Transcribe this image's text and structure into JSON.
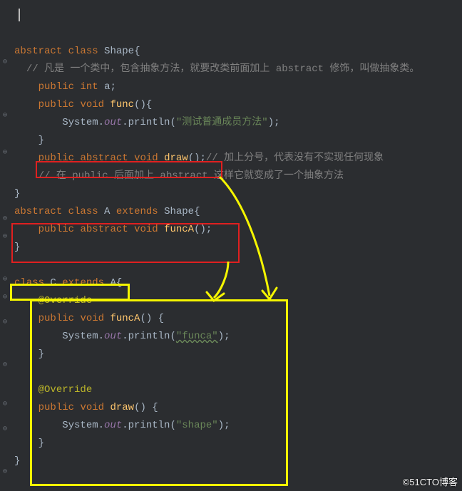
{
  "code": {
    "l1_kw1": "abstract",
    "l1_kw2": "class",
    "l1_ident": "Shape",
    "l1_brace": "{",
    "l2_comment": "// 凡是 一个类中，包含抽象方法，就要改类前面加上 abstract 修饰，叫做抽象类。",
    "l3_kw1": "public",
    "l3_kw2": "int",
    "l3_ident": "a",
    "l3_semi": ";",
    "l4_kw1": "public",
    "l4_kw2": "void",
    "l4_method": "func",
    "l4_end": "(){",
    "l5_a": "System.",
    "l5_out": "out",
    "l5_b": ".println(",
    "l5_str": "\"测试普通成员方法\"",
    "l5_c": ");",
    "l6_brace": "}",
    "l7_kw1": "public",
    "l7_kw2": "abstract",
    "l7_kw3": "void",
    "l7_method": "draw",
    "l7_end": "();",
    "l7_comment": "// 加上分号，代表没有不实现任何现象",
    "l8_comment": "// 在 public 后面加上 abstract 这样它就变成了一个抽象方法",
    "l9_brace": "}",
    "l10_kw1": "abstract",
    "l10_kw2": "class",
    "l10_a": "A",
    "l10_kw3": "extends",
    "l10_shape": "Shape",
    "l10_brace": "{",
    "l11_kw1": "public",
    "l11_kw2": "abstract",
    "l11_kw3": "void",
    "l11_method": "funcA",
    "l11_end": "();",
    "l12_brace": "}",
    "l13_kw1": "class",
    "l13_c": "C",
    "l13_kw2": "extends",
    "l13_a": "A",
    "l13_brace": "{",
    "l14_anno": "@Override",
    "l15_kw1": "public",
    "l15_kw2": "void",
    "l15_method": "funcA",
    "l15_end": "() {",
    "l16_a": "System.",
    "l16_out": "out",
    "l16_b": ".println(",
    "l16_str": "\"funca\"",
    "l16_c": ");",
    "l17_brace": "}",
    "l18_anno": "@Override",
    "l19_kw1": "public",
    "l19_kw2": "void",
    "l19_method": "draw",
    "l19_end": "() {",
    "l20_a": "System.",
    "l20_out": "out",
    "l20_b": ".println(",
    "l20_str": "\"shape\"",
    "l20_c": ");",
    "l21_brace": "}",
    "l22_brace": "}"
  },
  "watermark": "©51CTO博客"
}
